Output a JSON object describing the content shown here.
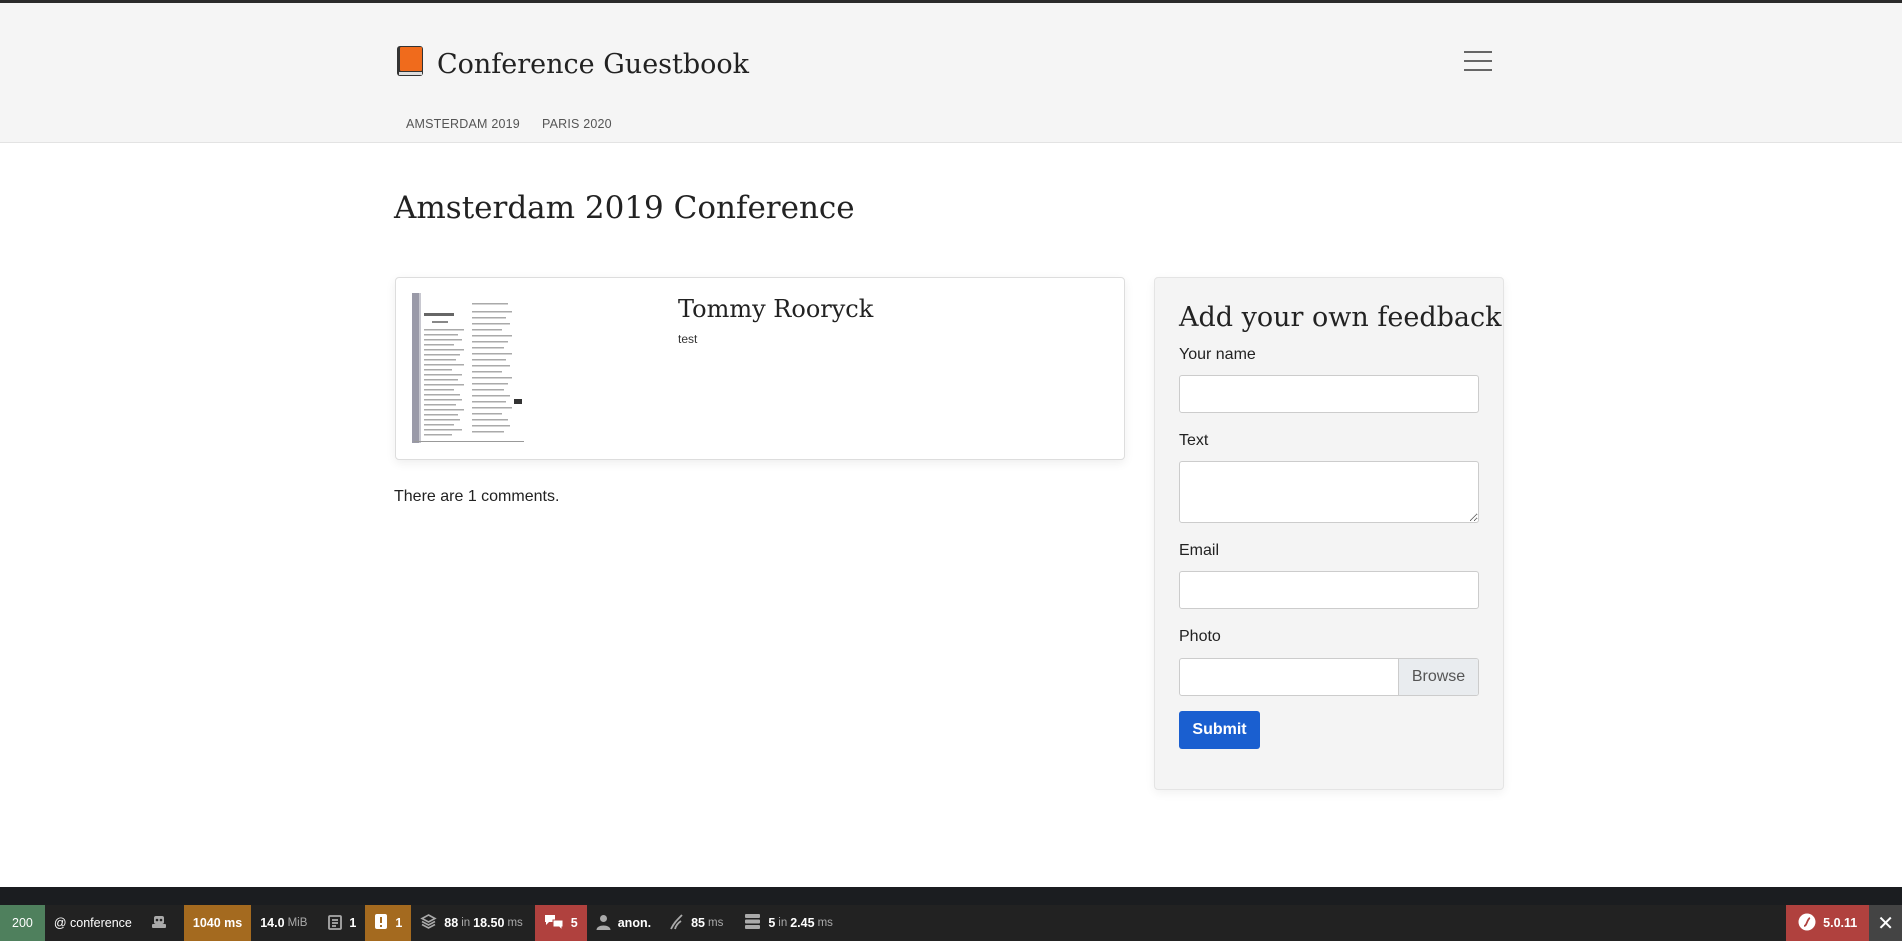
{
  "brand": {
    "title": "Conference Guestbook",
    "accent": "#f06b1c"
  },
  "nav": [
    {
      "label": "AMSTERDAM 2019"
    },
    {
      "label": "PARIS 2020"
    }
  ],
  "page": {
    "title": "Amsterdam 2019 Conference"
  },
  "comments": [
    {
      "author": "Tommy Rooryck",
      "text": "test",
      "photo_icon": "document-scan-thumbnail"
    }
  ],
  "comments_count_text": "There are 1 comments.",
  "form": {
    "title": "Add your own feedback",
    "name_label": "Your name",
    "text_label": "Text",
    "email_label": "Email",
    "photo_label": "Photo",
    "browse_label": "Browse",
    "submit_label": "Submit"
  },
  "toolbar": {
    "status": "200",
    "route": "@ conference",
    "time": "1040 ms",
    "memory_value": "14.0",
    "memory_unit": "MiB",
    "forms": "1",
    "errors": "1",
    "twig_count": "88",
    "twig_in": "in",
    "twig_time": "18.50",
    "twig_unit": "ms",
    "translations": "5",
    "user": "anon.",
    "events_time": "85",
    "events_unit": "ms",
    "db_count": "5",
    "db_in": "in",
    "db_time": "2.45",
    "db_unit": "ms",
    "symfony_version": "5.0.11",
    "close_glyph": "✕"
  }
}
